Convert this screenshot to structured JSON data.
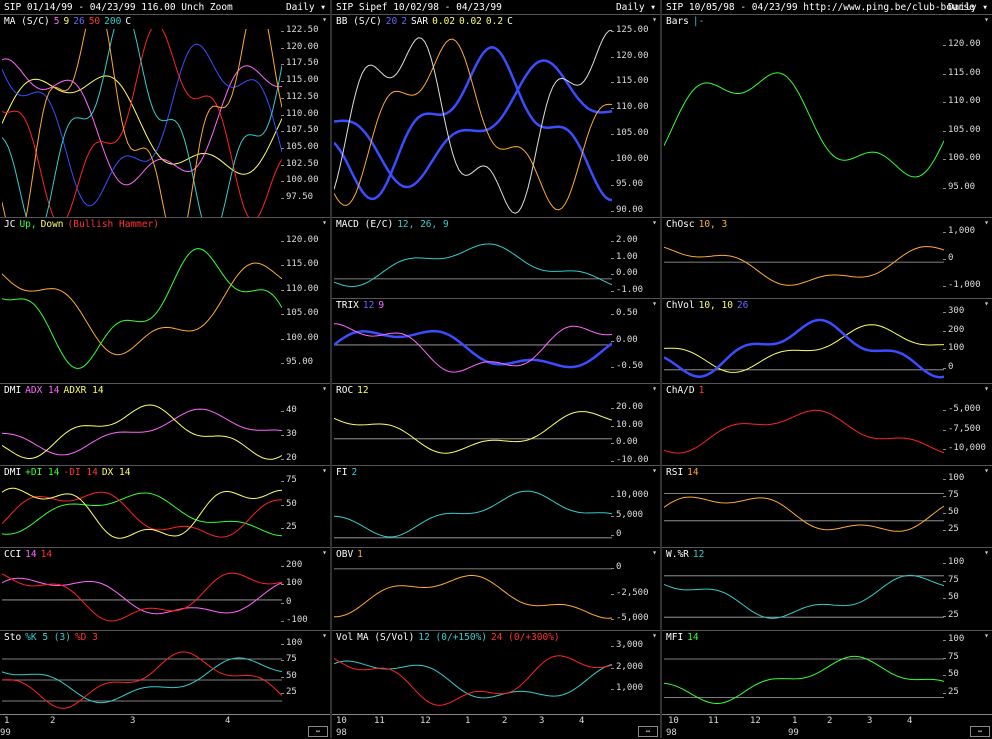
{
  "columns": [
    {
      "title": "SIP  01/14/99 - 04/23/99    116.00  Unch    Zoom",
      "daily": "Daily",
      "x_labels": [
        "1",
        "2",
        "3",
        "4"
      ],
      "year_labels": [
        "99"
      ],
      "panels": [
        {
          "label": "MA (S/C)",
          "extra": [
            {
              "t": "5",
              "c": "#ff66ff"
            },
            {
              "t": "9",
              "c": "#ffff66"
            },
            {
              "t": "26",
              "c": "#6666ff"
            },
            {
              "t": "50",
              "c": "#ff3333"
            },
            {
              "t": "200",
              "c": "#33cccc"
            },
            {
              "t": "C",
              "c": "#ffffff"
            }
          ],
          "ticks": [
            "122.50",
            "120.00",
            "117.50",
            "115.00",
            "112.50",
            "110.00",
            "107.50",
            "105.00",
            "102.50",
            "100.00",
            "97.50"
          ]
        },
        {
          "label": "JC",
          "extra": [
            {
              "t": "Up,",
              "c": "#33ff33"
            },
            {
              "t": "Down",
              "c": "#ffff66"
            },
            {
              "t": "(Bullish Hammer)",
              "c": "#ff3333"
            }
          ],
          "ticks": [
            "120.00",
            "115.00",
            "110.00",
            "105.00",
            "100.00",
            "95.00"
          ]
        },
        {
          "label": "DMI",
          "extra": [
            {
              "t": "ADX 14",
              "c": "#ff66ff"
            },
            {
              "t": "ADXR 14",
              "c": "#ffff66"
            }
          ],
          "ticks": [
            "40",
            "30",
            "20"
          ]
        },
        {
          "label": "DMI",
          "extra": [
            {
              "t": "+DI 14",
              "c": "#33ff33"
            },
            {
              "t": "-DI 14",
              "c": "#ff3333"
            },
            {
              "t": "DX 14",
              "c": "#ffff66"
            }
          ],
          "ticks": [
            "75",
            "50",
            "25"
          ]
        },
        {
          "label": "CCI",
          "extra": [
            {
              "t": "14",
              "c": "#ff66ff"
            },
            {
              "t": "14",
              "c": "#ff3333"
            }
          ],
          "ticks": [
            "200",
            "100",
            "0",
            "-100"
          ]
        },
        {
          "label": "Sto",
          "extra": [
            {
              "t": "%K 5 (3)",
              "c": "#33cccc"
            },
            {
              "t": "%D 3",
              "c": "#ff3333"
            }
          ],
          "ticks": [
            "100",
            "75",
            "50",
            "25"
          ]
        }
      ]
    },
    {
      "title": "SIP  Sipef  10/02/98 - 04/23/99",
      "daily": "Daily",
      "x_labels": [
        "10",
        "11",
        "12",
        "1",
        "2",
        "3",
        "4"
      ],
      "year_labels": [
        "98"
      ],
      "panels": [
        {
          "label": "BB (S/C)",
          "extra": [
            {
              "t": "20",
              "c": "#6666ff"
            },
            {
              "t": "2",
              "c": "#6666ff"
            },
            {
              "t": "SAR",
              "c": "#ffffff"
            },
            {
              "t": "0.02",
              "c": "#ffff66"
            },
            {
              "t": "0.02",
              "c": "#ffff66"
            },
            {
              "t": "0.2",
              "c": "#ffff66"
            },
            {
              "t": "C",
              "c": "#ffffff"
            }
          ],
          "ticks": [
            "125.00",
            "120.00",
            "115.00",
            "110.00",
            "105.00",
            "100.00",
            "95.00",
            "90.00"
          ]
        },
        {
          "label": "MACD (E/C)",
          "extra": [
            {
              "t": "12, 26, 9",
              "c": "#33cccc"
            }
          ],
          "ticks": [
            "2.00",
            "1.00",
            "0.00",
            "-1.00"
          ]
        },
        {
          "label": "TRIX",
          "extra": [
            {
              "t": "12",
              "c": "#6666ff"
            },
            {
              "t": "9",
              "c": "#ff66ff"
            }
          ],
          "ticks": [
            "0.50",
            "0.00",
            "-0.50"
          ]
        },
        {
          "label": "ROC",
          "extra": [
            {
              "t": "12",
              "c": "#ffff66"
            }
          ],
          "ticks": [
            "20.00",
            "10.00",
            "0.00",
            "-10.00"
          ]
        },
        {
          "label": "FI",
          "extra": [
            {
              "t": "2",
              "c": "#33cccc"
            }
          ],
          "ticks": [
            "10,000",
            "5,000",
            "0"
          ]
        },
        {
          "label": "OBV",
          "extra": [
            {
              "t": "1",
              "c": "#ffaa33"
            }
          ],
          "ticks": [
            "0",
            "-2,500",
            "-5,000"
          ]
        },
        {
          "label": "Vol",
          "extra": [
            {
              "t": "MA (S/Vol)",
              "c": "#ffffff"
            },
            {
              "t": "12 (0/+150%)",
              "c": "#33cccc"
            },
            {
              "t": "24 (0/+300%)",
              "c": "#ff3333"
            }
          ],
          "ticks": [
            "3,000",
            "2,000",
            "1,000"
          ]
        }
      ]
    },
    {
      "title": "SIP  10/05/98 - 04/23/99       http://www.ping.be/club-bourse",
      "daily": "Daily",
      "x_labels": [
        "10",
        "11",
        "12",
        "1",
        "2",
        "3",
        "4"
      ],
      "year_labels": [
        "98",
        "99"
      ],
      "panels": [
        {
          "label": "Bars",
          "extra": [
            {
              "t": "|-",
              "c": "#33cccc"
            }
          ],
          "ticks": [
            "120.00",
            "115.00",
            "110.00",
            "105.00",
            "100.00",
            "95.00"
          ]
        },
        {
          "label": "ChOsc",
          "extra": [
            {
              "t": "10, 3",
              "c": "#ffaa33"
            }
          ],
          "ticks": [
            "1,000",
            "0",
            "-1,000"
          ]
        },
        {
          "label": "ChVol",
          "extra": [
            {
              "t": "10, 10",
              "c": "#ffff66"
            },
            {
              "t": "26",
              "c": "#6666ff"
            }
          ],
          "ticks": [
            "300",
            "200",
            "100",
            "0"
          ]
        },
        {
          "label": "ChA/D",
          "extra": [
            {
              "t": "1",
              "c": "#ff3333"
            }
          ],
          "ticks": [
            "-5,000",
            "-7,500",
            "-10,000"
          ]
        },
        {
          "label": "RSI",
          "extra": [
            {
              "t": "14",
              "c": "#ffaa33"
            }
          ],
          "ticks": [
            "100",
            "75",
            "50",
            "25"
          ]
        },
        {
          "label": "W.%R",
          "extra": [
            {
              "t": "12",
              "c": "#33cccc"
            }
          ],
          "ticks": [
            "100",
            "75",
            "50",
            "25"
          ]
        },
        {
          "label": "MFI",
          "extra": [
            {
              "t": "14",
              "c": "#33ff33"
            }
          ],
          "ticks": [
            "100",
            "75",
            "50",
            "25"
          ]
        }
      ]
    }
  ]
}
